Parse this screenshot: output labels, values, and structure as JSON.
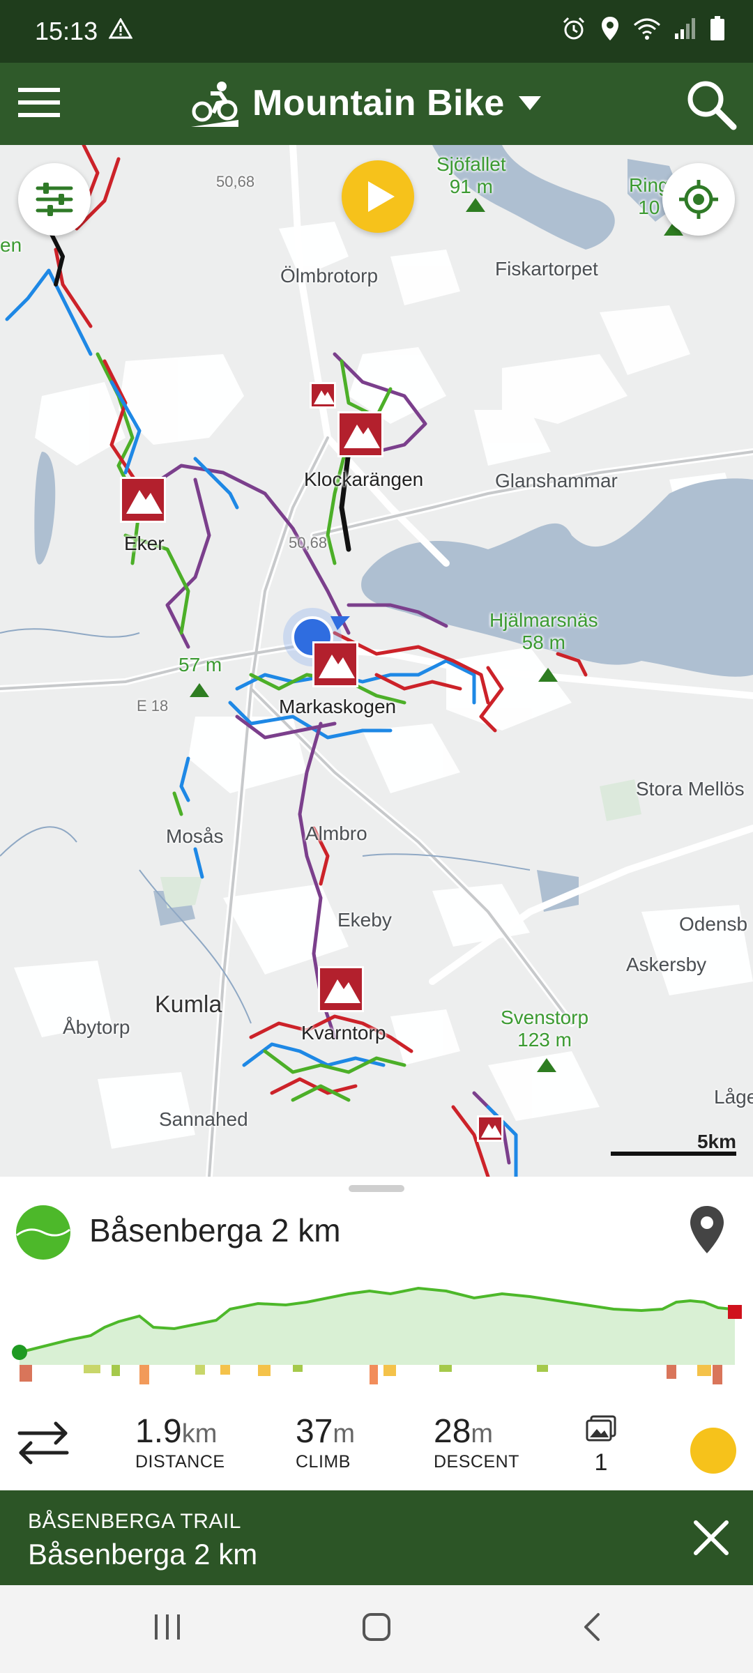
{
  "status_bar": {
    "time": "15:13"
  },
  "app_bar": {
    "title": "Mountain Bike"
  },
  "map": {
    "places": {
      "olmbrotorp": "Ölmbrotorp",
      "fiskartorpet": "Fiskartorpet",
      "glanshammar": "Glanshammar",
      "klockarangen": "Klockarängen",
      "eker": "Eker",
      "markaskogen": "Markaskogen",
      "stora_mellos": "Stora Mellös",
      "mosas": "Mosås",
      "almbro": "Almbro",
      "ekeby": "Ekeby",
      "odensb": "Odensb",
      "askersby": "Askersby",
      "kumla": "Kumla",
      "abytorp": "Åbytorp",
      "kvarntorp": "Kvarntorp",
      "sannahed": "Sannahed",
      "lage": "Låge",
      "en": "en"
    },
    "peaks": {
      "sjofallet_name": "Sjöfallet",
      "sjofallet_height": "91 m",
      "ring_name": "Ring",
      "ring_height": "10",
      "hjalmarsnas_name": "Hjälmarsnäs",
      "hjalmarsnas_height": "58 m",
      "svenstorp_name": "Svenstorp",
      "svenstorp_height": "123 m",
      "unnamed_height": "57 m"
    },
    "roads": {
      "r1": "50,68",
      "r2": "50,68",
      "e18": "E 18"
    },
    "scale": "5km"
  },
  "trail": {
    "name": "Båsenberga 2 km",
    "distance_value": "1.9",
    "distance_unit": "km",
    "distance_label": "DISTANCE",
    "climb_value": "37",
    "climb_unit": "m",
    "climb_label": "CLIMB",
    "descent_value": "28",
    "descent_unit": "m",
    "descent_label": "DESCENT",
    "photos_count": "1",
    "difficulty_color": "#f6c21b"
  },
  "trail_bar": {
    "subtitle": "BÅSENBERGA TRAIL",
    "title": "Båsenberga 2 km"
  },
  "colors": {
    "app_green": "#2f5a2a",
    "accent_yellow": "#f6c21b",
    "poi_red": "#b3202d",
    "trail_green": "#4db82a"
  }
}
